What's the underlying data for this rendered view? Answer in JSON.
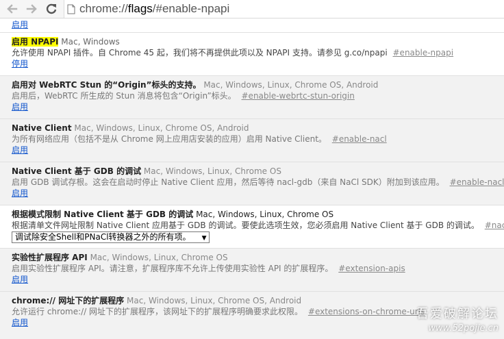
{
  "browser": {
    "url_scheme": "chrome://",
    "url_host": "flags",
    "url_path": "/#enable-npapi"
  },
  "top_partial": {
    "action_label": "启用"
  },
  "flags": [
    {
      "name": "启用 NPAPI",
      "platforms": "Mac, Windows",
      "description": "允许使用 NPAPI 插件。自 Chrome 45 起，我们将不再提供此项以及 NPAPI 支持。请参见 g.co/npapi",
      "anchor": "#enable-npapi",
      "action_label": "停用",
      "highlighted": true,
      "unsupported": false
    },
    {
      "name": "启用对 WebRTC Stun 的“Origin”标头的支持。",
      "platforms": "Mac, Windows, Linux, Chrome OS, Android",
      "description": "启用后，WebRTC 所生成的 Stun 消息将包含“Origin”标头。",
      "anchor": "#enable-webrtc-stun-origin",
      "action_label": "启用",
      "unsupported": true
    },
    {
      "name": "Native Client",
      "platforms": "Mac, Windows, Linux, Chrome OS, Android",
      "description": "为所有网络应用（包括不是从 Chrome 网上应用店安装的应用）启用 Native Client。",
      "anchor": "#enable-nacl",
      "action_label": "启用",
      "unsupported": true
    },
    {
      "name": "Native Client 基于 GDB 的调试",
      "platforms": "Mac, Windows, Linux, Chrome OS",
      "description": "启用 GDB 调试存根。这会在启动时停止 Native Client 应用，然后等待 nacl-gdb（来自 NaCl SDK）附加到该应用。",
      "anchor": "#enable-nacl-debug",
      "action_label": "启用",
      "unsupported": true
    },
    {
      "name": "根据模式限制 Native Client 基于 GDB 的调试",
      "platforms": "Mac, Windows, Linux, Chrome OS",
      "description": "根据清单文件网址限制 Native Client 应用基于 GDB 的调试。要使此选项生效，您必须启用 Native Client 基于 GDB 的调试。",
      "anchor": "#nacl-debug",
      "select_value": "调试除安全Shell和PNaCl转换器之外的所有项。",
      "unsupported": false
    },
    {
      "name": "实验性扩展程序 API",
      "platforms": "Mac, Windows, Linux, Chrome OS",
      "description": "启用实验性扩展程序 API。请注意，扩展程序库不允许上传使用实验性 API 的扩展程序。",
      "anchor": "#extension-apis",
      "action_label": "启用",
      "unsupported": true
    },
    {
      "name": "chrome:// 网址下的扩展程序",
      "platforms": "Mac, Windows, Linux, Chrome OS, Android",
      "description": "允许运行 chrome:// 网址下的扩展程序，该网址下的扩展程序明确要求此权限。",
      "anchor": "#extensions-on-chrome-urls",
      "action_label": "启用",
      "unsupported": true
    }
  ],
  "watermark": {
    "text": "吾爱破解论坛",
    "url": "www.52pojie.cn"
  },
  "colors": {
    "link": "#1155cc",
    "highlight": "#ffff00",
    "unsupported_bg": "#f2f2f2"
  }
}
